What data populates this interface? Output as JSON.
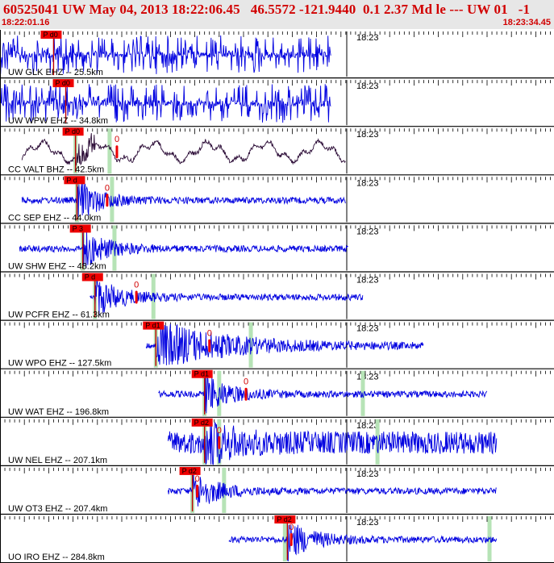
{
  "header": {
    "title": "60525041 UW May 04, 2013 18:22:06.45   46.5572 -121.9440  0.1 2.37 Md le --- UW 01   -1",
    "start_time": "18:22:01.16",
    "end_time": "18:23:34.45"
  },
  "colors": {
    "header_text": "#d10000",
    "trace_blue": "#0000e0",
    "trace_broadband": "#2a0a35",
    "pick_flag": "#ee0000",
    "arrival_band": "#b6e3b6",
    "header_bg": "#e7e7e7"
  },
  "traces": [
    {
      "label": "UW GLK EHZ -- 25.5km",
      "minute": "18:23",
      "pick": "P d0",
      "amp": "clip",
      "tStart": 0,
      "tEnd": 68,
      "tP": 11,
      "tS": null,
      "cut": true,
      "bands": []
    },
    {
      "label": "UW WPW EHZ -- 34.8km",
      "minute": "18:23",
      "pick": "P d0",
      "amp": "clip",
      "tStart": 0,
      "tEnd": 68,
      "tP": 13.5,
      "tS": null,
      "cut": true,
      "bands": []
    },
    {
      "label": "CC VALT BHZ -- 42.5km",
      "minute": "18:23",
      "pick": "P d0",
      "amp": "broad",
      "tStart": 4.5,
      "tEnd": 71,
      "tP": 15.5,
      "tS": 24,
      "cut": false,
      "bands": [
        15.5,
        22.5
      ]
    },
    {
      "label": "CC SEP EHZ -- 44.0km",
      "minute": "18:23",
      "pick": "P d",
      "amp": "std",
      "tStart": 4.5,
      "tEnd": 71,
      "tP": 15.8,
      "tS": 22,
      "cut": false,
      "bands": [
        15.8,
        23
      ]
    },
    {
      "label": "UW SHW EHZ -- 48.2km",
      "minute": "18:23",
      "pick": "P 3",
      "amp": "std",
      "tStart": 4,
      "tEnd": 71.5,
      "tP": 17,
      "tS": null,
      "cut": false,
      "bands": [
        17,
        23.5
      ]
    },
    {
      "label": "UW PCFR EHZ -- 61.3km",
      "minute": "18:23",
      "pick": "P d",
      "amp": "std",
      "tStart": 18.5,
      "tEnd": 74.5,
      "tP": 19.5,
      "tS": 28,
      "cut": false,
      "bands": [
        19.5,
        31.5
      ]
    },
    {
      "label": "UW WPO EHZ -- 127.5km",
      "minute": "18:23",
      "pick": "P d1",
      "amp": "big",
      "tStart": 30,
      "tEnd": 87,
      "tP": 32,
      "tS": 43,
      "cut": false,
      "bands": [
        32,
        51.5
      ]
    },
    {
      "label": "UW WAT EHZ -- 196.8km",
      "minute": "18:23",
      "pick": "P d1",
      "amp": "std",
      "tStart": 32.5,
      "tEnd": 100,
      "tP": 42,
      "tS": 50.5,
      "cut": false,
      "bands": [
        42,
        45,
        74.5
      ]
    },
    {
      "label": "UW NEL EHZ -- 207.1km",
      "minute": "18:23",
      "pick": "P d2",
      "amp": "noisy",
      "tStart": 34.5,
      "tEnd": 102,
      "tP": 42,
      "tS": 45,
      "cut": false,
      "bands": [
        42,
        45,
        77.5
      ]
    },
    {
      "label": "UW OT3 EHZ -- 207.4km",
      "minute": "18:23",
      "pick": "P d2",
      "amp": "std",
      "tStart": 34.5,
      "tEnd": 102,
      "tP": 39.5,
      "tS": 40.5,
      "cut": false,
      "bands": [
        39.5,
        46
      ]
    },
    {
      "label": "UO IRO EHZ -- 284.8km",
      "minute": "18:23",
      "pick": "P d2",
      "amp": "std",
      "tStart": 47,
      "tEnd": 102,
      "tP": 59,
      "tS": 59.8,
      "cut": false,
      "bands": [
        58.5,
        100.5
      ]
    }
  ]
}
